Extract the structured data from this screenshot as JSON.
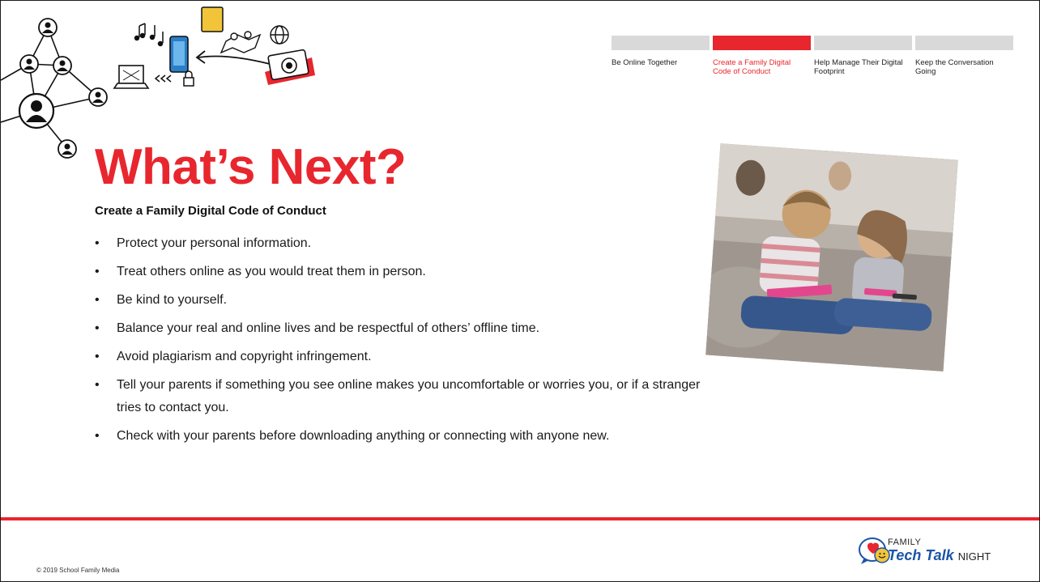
{
  "progress": {
    "steps": [
      {
        "label": "Be Online Together",
        "active": false
      },
      {
        "label": "Create a Family Digital Code of Conduct",
        "active": true
      },
      {
        "label": "Help Manage Their Digital Footprint",
        "active": false
      },
      {
        "label": "Keep the Conversation Going",
        "active": false
      }
    ]
  },
  "content": {
    "title": "What’s Next?",
    "subtitle": "Create a Family Digital Code of Conduct",
    "bullets": [
      "Protect your personal information.",
      "Treat others online as you would treat them in person.",
      "Be kind to yourself.",
      "Balance your real and online lives and be respectful of others’ offline time.",
      "Avoid plagiarism and copyright infringement.",
      "Tell your parents if something you see online makes you uncomfortable or worries you, or if a stranger tries to contact you.",
      "Check with your parents before downloading anything or connecting with anyone new."
    ]
  },
  "logo": {
    "family": "FAMILY",
    "tech_talk": "Tech Talk",
    "night": "NIGHT"
  },
  "footer": {
    "copyright": "© 2019 School Family Media"
  },
  "colors": {
    "accent": "#e8262e",
    "inactive_bar": "#d9d9d9",
    "logo_blue": "#1b55a6"
  },
  "icons": [
    "user-node-icon",
    "music-notes-icon",
    "tablet-icon",
    "laptop-icon",
    "lock-icon",
    "map-pins-icon",
    "globe-icon",
    "camera-icon",
    "chat-bubbles-icon"
  ]
}
